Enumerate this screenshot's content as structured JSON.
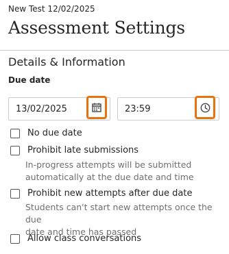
{
  "header": {
    "breadcrumb": "New Test 12/02/2025",
    "title": "Assessment Settings"
  },
  "section": {
    "title": "Details & Information"
  },
  "due_date": {
    "label": "Due date",
    "date_value": "13/02/2025",
    "time_value": "23:59",
    "date_icon": "calendar-icon",
    "time_icon": "clock-icon"
  },
  "options": [
    {
      "label": "No due date",
      "checked": false
    },
    {
      "label": "Prohibit late submissions",
      "checked": false,
      "helper_line1": "In-progress attempts will be submitted",
      "helper_line2": "automatically at the due date and time"
    },
    {
      "label": "Prohibit new attempts after due date",
      "checked": false,
      "helper_line1": "Students can't start new attempts once the due",
      "helper_line2": "date and time has passed"
    },
    {
      "label": "Allow class conversations",
      "checked": false
    }
  ],
  "colors": {
    "highlight": "#e8730e",
    "text": "#262626",
    "helper_text": "#6f6f6f",
    "border": "#cdcdcd"
  }
}
